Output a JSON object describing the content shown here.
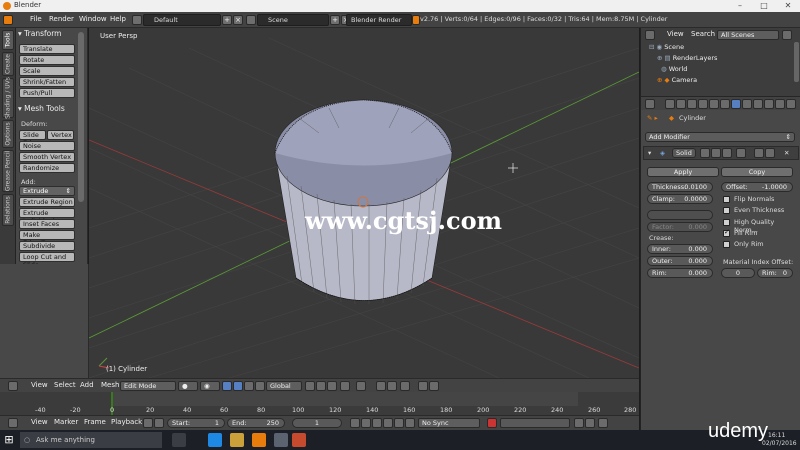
{
  "title_bar": {
    "title": "Blender"
  },
  "menu": {
    "file": "File",
    "render": "Render",
    "window": "Window",
    "help": "Help"
  },
  "screen_layout": "Default",
  "scene_name": "Scene",
  "render_engine": "Blender Render",
  "stats": "v2.76 | Verts:0/64 | Edges:0/96 | Faces:0/32 | Tris:64 | Mem:8.75M | Cylinder",
  "left_tabs": [
    "Tools",
    "Create",
    "Shading / UVs",
    "Options",
    "Grease Pencil",
    "Relations"
  ],
  "tool_shelf": {
    "transform_header": "Transform",
    "transform_buttons": [
      "Translate",
      "Rotate",
      "Scale",
      "Shrink/Fatten",
      "Push/Pull"
    ],
    "mesh_tools_header": "Mesh Tools",
    "deform_label": "Deform:",
    "slide_edge": "Slide Ed",
    "vertex": "Vertex",
    "deform_buttons": [
      "Noise",
      "Smooth Vertex",
      "Randomize"
    ],
    "add_label": "Add:",
    "extrude": "Extrude",
    "add_buttons": [
      "Extrude Region",
      "Extrude Individual",
      "Inset Faces",
      "Make Edge/Face",
      "Subdivide",
      "Loop Cut and Slide"
    ]
  },
  "viewport": {
    "view_label": "User Persp",
    "object_label": "(1) Cylinder",
    "watermark": "www.cgtsj.com"
  },
  "viewport_header": {
    "view": "View",
    "select": "Select",
    "add": "Add",
    "mesh": "Mesh",
    "mode": "Edit Mode",
    "orientation": "Global"
  },
  "timeline": {
    "ticks": [
      "-40",
      "-20",
      "0",
      "20",
      "40",
      "60",
      "80",
      "100",
      "120",
      "140",
      "160",
      "180",
      "200",
      "220",
      "240",
      "260",
      "280"
    ],
    "view": "View",
    "marker": "Marker",
    "frame": "Frame",
    "playback": "Playback",
    "start_label": "Start:",
    "start_value": "1",
    "end_label": "End:",
    "end_value": "250",
    "current_frame": "1",
    "sync": "No Sync"
  },
  "outliner": {
    "view": "View",
    "search": "Search",
    "filter": "All Scenes",
    "items": [
      "Scene",
      "RenderLayers",
      "World",
      "Camera"
    ]
  },
  "properties": {
    "object_name": "Cylinder",
    "add_modifier": "Add Modifier",
    "modifier_name": "Solid",
    "apply": "Apply",
    "copy": "Copy",
    "thickness_label": "Thickness:",
    "thickness_value": "0.0100",
    "offset_label": "Offset:",
    "offset_value": "-1.0000",
    "clamp_label": "Clamp:",
    "clamp_value": "0.0000",
    "factor_label": "Factor:",
    "factor_value": "0.000",
    "flip_normals": "Flip Normals",
    "even_thickness": "Even Thickness",
    "high_quality": "High Quality Norm...",
    "fill_rim": "Fill Rim",
    "only_rim": "Only Rim",
    "crease_label": "Crease:",
    "inner_label": "Inner:",
    "inner_value": "0.000",
    "outer_label": "Outer:",
    "outer_value": "0.000",
    "rim_label": "Rim:",
    "rim_value": "0.000",
    "mat_index_label": "Material Index Offset:",
    "mat_value": "0",
    "mat_rim_label": "Rim:",
    "mat_rim_value": "0"
  },
  "taskbar": {
    "search_placeholder": "Ask me anything",
    "time": "16:11",
    "date": "02/07/2016"
  },
  "brand": "udemy",
  "colors": {
    "accent_orange": "#e87d0d",
    "selection_blue": "#5680c2",
    "timeline_green": "#3a7a1e"
  }
}
